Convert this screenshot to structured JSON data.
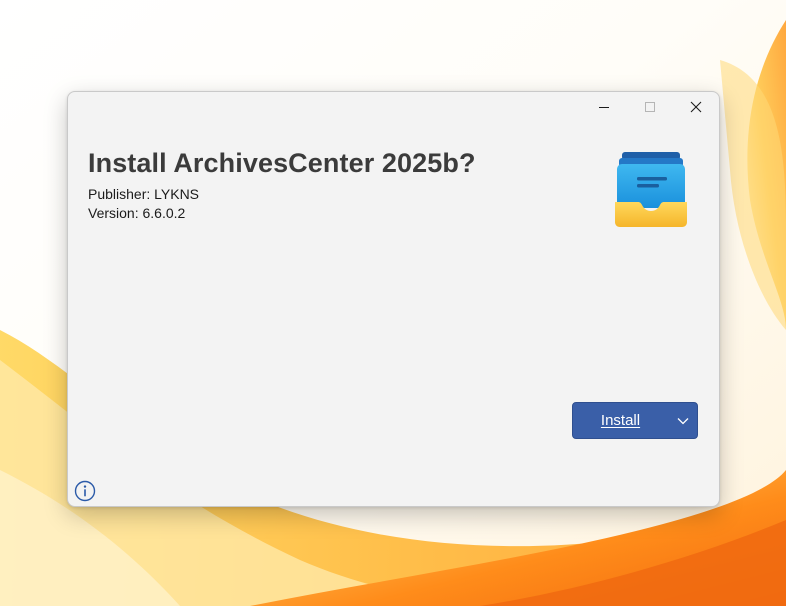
{
  "dialog": {
    "title": "Install ArchivesCenter 2025b?",
    "publisher": "Publisher: LYKNS",
    "version": "Version: 6.6.0.2",
    "install_label": "Install",
    "icons": {
      "app": "archive-tray-icon",
      "info": "info-icon",
      "dropdown": "chevron-down-icon",
      "minimize": "minimize-icon",
      "maximize": "maximize-icon",
      "close": "close-icon"
    }
  },
  "colors": {
    "accent": "#3a5fa8",
    "dialog_bg": "#f3f3f3",
    "title_text": "#3b3b3b",
    "info_icon": "#2b5aa8"
  }
}
